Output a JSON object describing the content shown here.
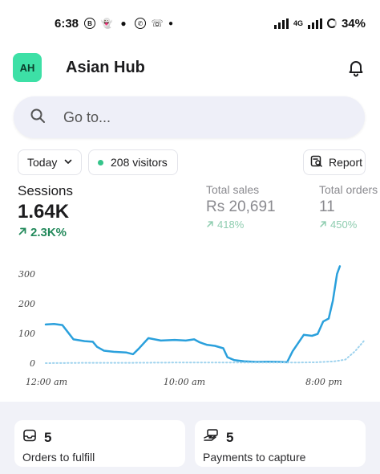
{
  "status_bar": {
    "time": "6:38",
    "network": "4G",
    "battery": "34%"
  },
  "header": {
    "avatar_initials": "AH",
    "store_name": "Asian Hub",
    "notifications_icon": "bell-icon"
  },
  "search": {
    "placeholder": "Go to..."
  },
  "filters": {
    "period": "Today",
    "visitors": "208 visitors",
    "report_label": "Report"
  },
  "metrics": [
    {
      "label": "Sessions",
      "value": "1.64K",
      "change": "2.3K%"
    },
    {
      "label": "Total sales",
      "value": "Rs 20,691",
      "change": "418%"
    },
    {
      "label": "Total orders",
      "value": "11",
      "change": "450%"
    }
  ],
  "chart_data": {
    "type": "line",
    "x_tick_labels": [
      "12:00 am",
      "10:00 am",
      "8:00 pm"
    ],
    "y_tick_labels": [
      "0",
      "100",
      "200",
      "300"
    ],
    "ylim": [
      0,
      330
    ],
    "xlim": [
      0,
      23
    ],
    "series": [
      {
        "style": "solid",
        "color": "#2aa0dc",
        "x": [
          0,
          0.6,
          1.2,
          1.5,
          2.0,
          2.8,
          3.4,
          3.7,
          4.2,
          4.9,
          5.8,
          6.3,
          6.7,
          7.4,
          8.3,
          9.3,
          10.1,
          10.7,
          11.1,
          11.6,
          12.2,
          12.8,
          13.1,
          13.6,
          14.3,
          15.2,
          16.0,
          16.9,
          17.4,
          17.8,
          18.6,
          19.2,
          19.6,
          20.0,
          20.4,
          20.7,
          21.0,
          21.2
        ],
        "y": [
          130,
          132,
          128,
          110,
          80,
          74,
          72,
          55,
          42,
          38,
          36,
          30,
          48,
          84,
          76,
          78,
          76,
          80,
          70,
          62,
          58,
          50,
          20,
          10,
          6,
          4,
          5,
          4,
          3,
          40,
          95,
          92,
          98,
          140,
          150,
          210,
          300,
          326
        ]
      },
      {
        "style": "dotted",
        "color": "#9fd3ee",
        "x": [
          0,
          3,
          6,
          9,
          12,
          15,
          18,
          19.5,
          20.8,
          21.6,
          22.3,
          23
        ],
        "y": [
          0,
          1,
          1,
          2,
          2,
          2,
          2,
          3,
          6,
          12,
          40,
          78
        ]
      }
    ]
  },
  "tiles": [
    {
      "count": "5",
      "label": "Orders to fulfill",
      "icon": "inbox-icon"
    },
    {
      "count": "5",
      "label": "Payments to capture",
      "icon": "hand-cash-icon"
    }
  ]
}
